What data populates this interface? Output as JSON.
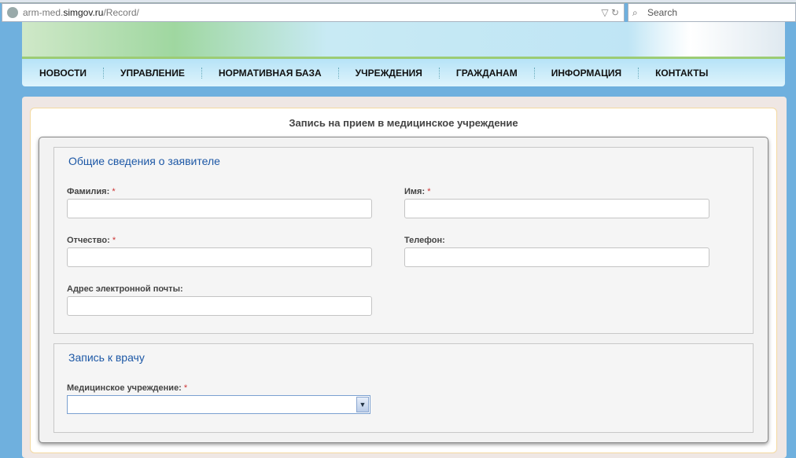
{
  "browser": {
    "url_prefix": "arm-med.",
    "url_domain": "simgov.ru",
    "url_path": "/Record/",
    "search_placeholder": "Search"
  },
  "nav": [
    "НОВОСТИ",
    "УПРАВЛЕНИЕ",
    "НОРМАТИВНАЯ БАЗА",
    "УЧРЕЖДЕНИЯ",
    "ГРАЖДАНАМ",
    "ИНФОРМАЦИЯ",
    "КОНТАКТЫ"
  ],
  "page_title": "Запись на прием в медицинское учреждение",
  "section1": {
    "legend": "Общие сведения о заявителе",
    "surname": "Фамилия:",
    "name": "Имя:",
    "patronymic": "Отчество:",
    "phone": "Телефон:",
    "email": "Адрес электронной почты:"
  },
  "section2": {
    "legend": "Запись к врачу",
    "institution": "Медицинское учреждение:"
  },
  "required_mark": "*"
}
